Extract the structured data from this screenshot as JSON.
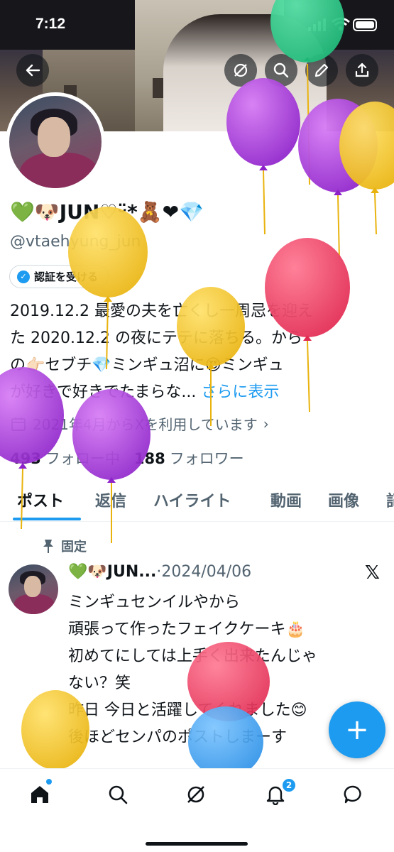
{
  "status_bar": {
    "time": "7:12"
  },
  "profile": {
    "name": "💚🐶JUN♡ᵕ̈*🧸❤💎",
    "handle": "@vtaehyung_jun",
    "verify_label": "認証を受ける",
    "bio_lines": [
      "2019.12.2 最愛の夫を亡くし一周忌を迎え",
      "た 2020.12.2 の夜にテテに落ちる。から",
      "の👉🏻セブチ💎ミンギュ沼に😍ミンギュ",
      "が好きで好きでたまらな..."
    ],
    "bio_more": "さらに表示",
    "joined": "2021年4月からXを利用しています",
    "following_count": "493",
    "following_label": "フォロー中",
    "followers_count": "188",
    "followers_label": "フォロワー"
  },
  "tabs": [
    "ポスト",
    "返信",
    "ハイライト",
    "動画",
    "画像",
    "記"
  ],
  "post": {
    "pinned_label": "固定",
    "author": "💚🐶JUN...",
    "date": "·2024/04/06",
    "lines": [
      "ミンギュセンイルやから",
      "頑張って作ったフェイクケーキ🎂",
      "初めてにしては上手く出来たんじゃ",
      "ない？笑",
      "昨日 今日と活躍してくれました😊",
      "後ほどセンパのポストしまーす"
    ]
  },
  "fab_label": "+",
  "nav": {
    "notifications_badge": "2"
  },
  "icons": {
    "back": "back-arrow-icon",
    "grok": "grok-icon",
    "search": "search-icon",
    "edit": "edit-icon",
    "share": "share-icon",
    "calendar": "calendar-icon",
    "pin": "pin-icon",
    "x_logo": "x-logo-icon"
  },
  "colors": {
    "accent": "#1d9bf0",
    "text": "#0f1419",
    "secondary_text": "#536471",
    "balloon_purple": "#a23bd8",
    "balloon_yellow": "#f2c21b",
    "balloon_red": "#ee3a5f",
    "balloon_green": "#2fcf8c",
    "balloon_blue": "#3ea3f0"
  }
}
